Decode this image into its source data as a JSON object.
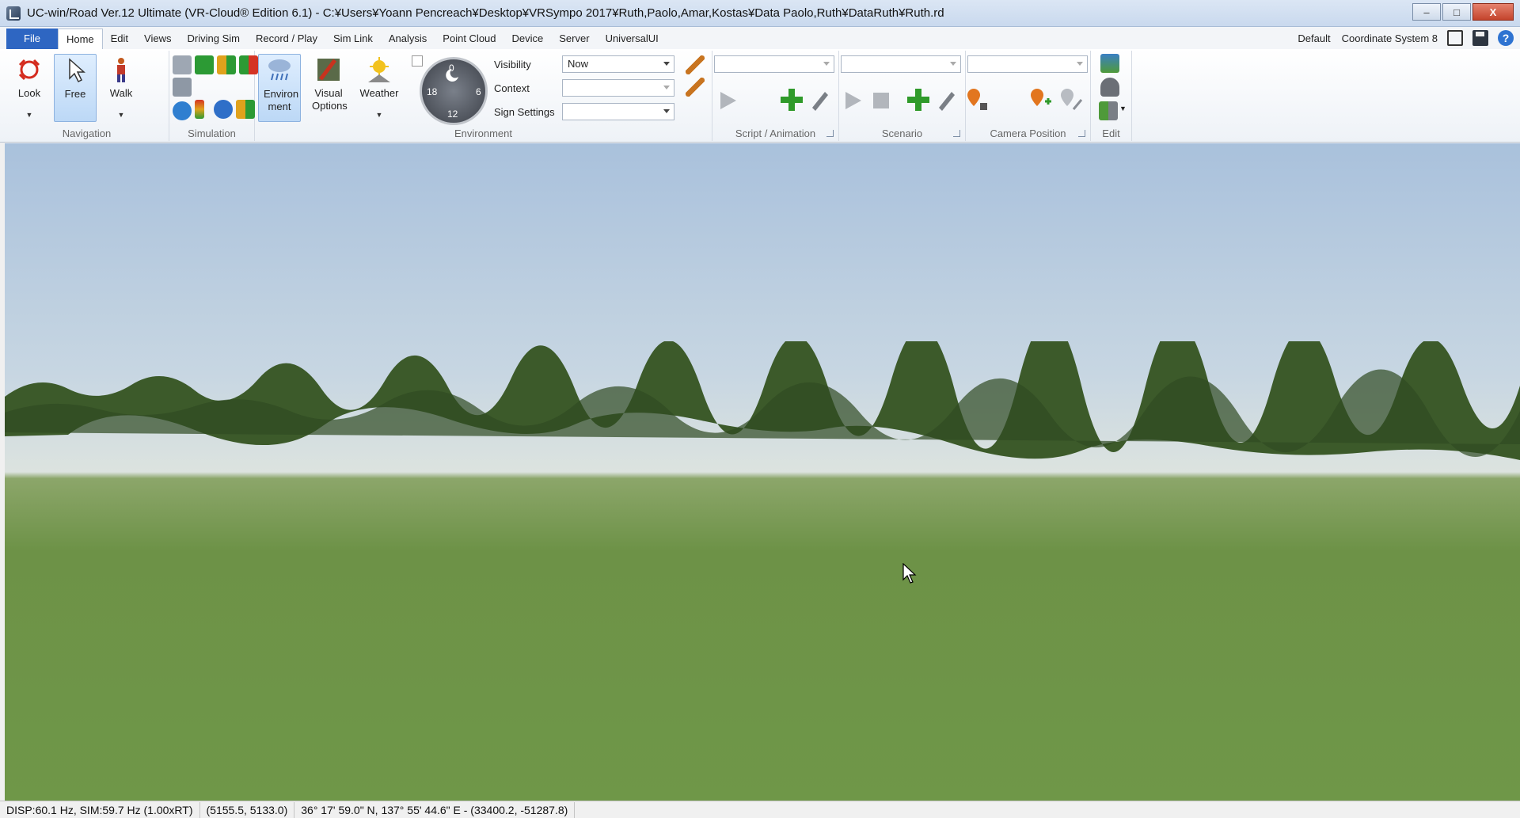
{
  "window": {
    "title": "UC-win/Road Ver.12 Ultimate (VR-Cloud® Edition 6.1) - C:¥Users¥Yoann Pencreach¥Desktop¥VRSympo 2017¥Ruth,Paolo,Amar,Kostas¥Data Paolo,Ruth¥DataRuth¥Ruth.rd",
    "controls": {
      "minimize": "–",
      "maximize": "□",
      "close": "X"
    }
  },
  "tabs": [
    {
      "label": "File"
    },
    {
      "label": "Home"
    },
    {
      "label": "Edit"
    },
    {
      "label": "Views"
    },
    {
      "label": "Driving Sim"
    },
    {
      "label": "Record / Play"
    },
    {
      "label": "Sim Link"
    },
    {
      "label": "Analysis"
    },
    {
      "label": "Point Cloud"
    },
    {
      "label": "Device"
    },
    {
      "label": "Server"
    },
    {
      "label": "UniversalUI"
    }
  ],
  "ribbon_right": {
    "preset": "Default",
    "coordinate_system": "Coordinate System 8",
    "help": "?"
  },
  "groups": {
    "navigation": {
      "label": "Navigation",
      "look": "Look",
      "free": "Free",
      "walk": "Walk"
    },
    "simulation": {
      "label": "Simulation"
    },
    "environment": {
      "label": "Environment",
      "environment_btn": "Environ ment",
      "visual_options": "Visual Options",
      "weather": "Weather",
      "clock": {
        "top": "0",
        "left": "18",
        "right": "6",
        "bottom": "12"
      },
      "visibility_label": "Visibility",
      "visibility_value": "Now",
      "context_label": "Context",
      "context_value": "",
      "sign_label": "Sign Settings",
      "sign_value": ""
    },
    "script": {
      "label": "Script / Animation",
      "value": ""
    },
    "scenario": {
      "label": "Scenario",
      "value": ""
    },
    "camera": {
      "label": "Camera Position",
      "value": ""
    },
    "edit": {
      "label": "Edit"
    }
  },
  "status": {
    "rates": "DISP:60.1 Hz, SIM:59.7 Hz (1.00xRT)",
    "position": "(5155.5, 5133.0)",
    "geo": "36° 17' 59.0\" N, 137° 55' 44.6\" E  -  (33400.2, -51287.8)"
  },
  "colors": {
    "file_tab": "#2e66c2",
    "accent_green": "#2f9a2a",
    "accent_orange": "#e2761f",
    "sky": "#a9c1dc",
    "grass": "#6f9748"
  }
}
